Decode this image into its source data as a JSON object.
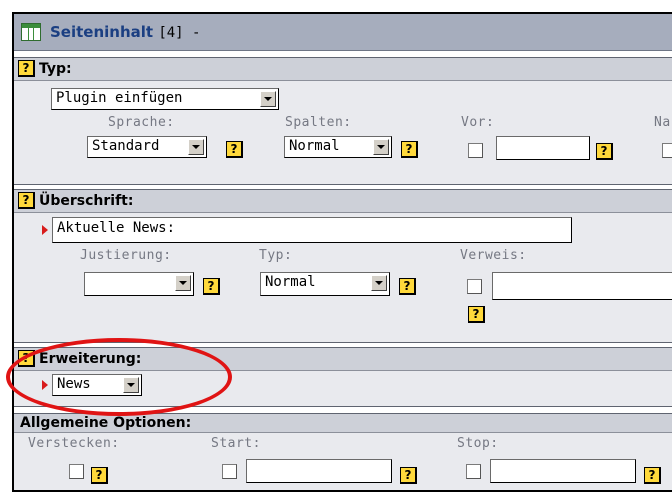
{
  "header": {
    "title": "Seiteninhalt",
    "suffix": "[4] -"
  },
  "typ_section": {
    "title": "Typ:",
    "type_value": "Plugin einfügen",
    "labels": {
      "sprache": "Sprache:",
      "spalten": "Spalten:",
      "vor": "Vor:",
      "na": "Na"
    },
    "sprache_value": "Standard",
    "spalten_value": "Normal",
    "vor_value": ""
  },
  "ueberschrift_section": {
    "title": "Überschrift:",
    "headline_value": "Aktuelle News:",
    "labels": {
      "justierung": "Justierung:",
      "typ": "Typ:",
      "verweis": "Verweis:"
    },
    "justierung_value": "",
    "typ_value": "Normal",
    "verweis_value": ""
  },
  "erweiterung_section": {
    "title": "Erweiterung:",
    "value": "News"
  },
  "allgemeine_section": {
    "title": "Allgemeine Optionen:",
    "labels": {
      "verstecken": "Verstecken:",
      "start": "Start:",
      "stop": "Stop:"
    },
    "start_value": "",
    "stop_value": ""
  },
  "help_icon_text": "?",
  "icons": {
    "page": "table-icon",
    "help": "help-icon",
    "required": "required-arrow-icon"
  },
  "colors": {
    "header_bg": "#a6adbd",
    "title_link": "#1b3f82",
    "highlight_ellipse": "#e01414",
    "help_icon": "#ffd93b"
  }
}
